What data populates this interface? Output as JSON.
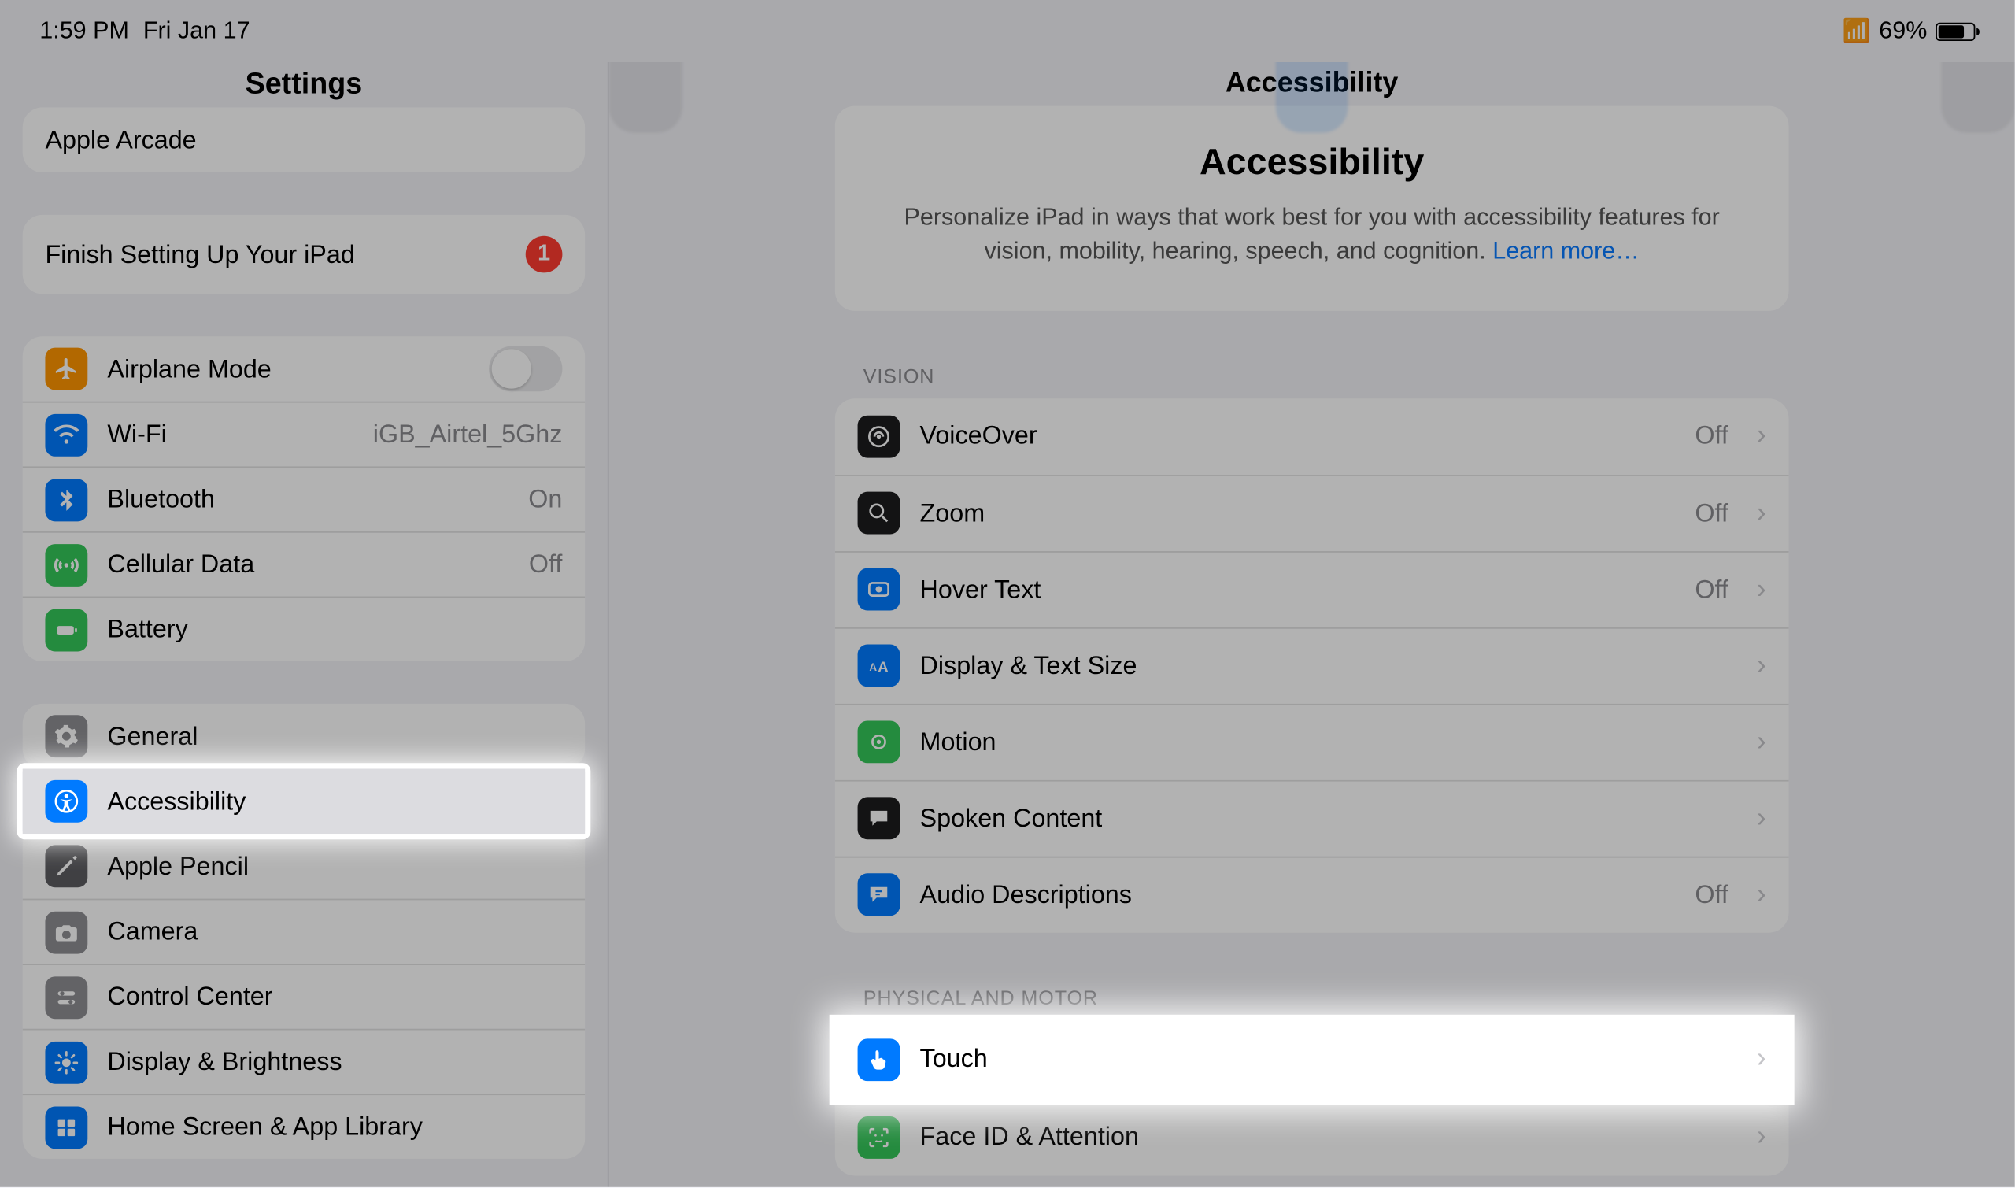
{
  "status": {
    "time": "1:59 PM",
    "date": "Fri Jan 17",
    "battery_pct": "69%"
  },
  "sidebar": {
    "title": "Settings",
    "top_row": {
      "label": "Apple Arcade"
    },
    "setup": {
      "label": "Finish Setting Up Your iPad",
      "badge": "1"
    },
    "conn": {
      "airplane": "Airplane Mode",
      "wifi": "Wi-Fi",
      "wifi_value": "iGB_Airtel_5Ghz",
      "bluetooth": "Bluetooth",
      "bluetooth_value": "On",
      "cellular": "Cellular Data",
      "cellular_value": "Off",
      "battery": "Battery"
    },
    "sys": {
      "general": "General",
      "accessibility": "Accessibility",
      "pencil": "Apple Pencil",
      "camera": "Camera",
      "control_center": "Control Center",
      "display": "Display & Brightness",
      "home": "Home Screen & App Library"
    }
  },
  "detail": {
    "small_title": "Accessibility",
    "hero_title": "Accessibility",
    "hero_text": "Personalize iPad in ways that work best for you with accessibility features for vision, mobility, hearing, speech, and cognition. ",
    "hero_link": "Learn more…",
    "section_vision": "Vision",
    "section_physical": "Physical and Motor",
    "vision": {
      "voiceover": "VoiceOver",
      "voiceover_value": "Off",
      "zoom": "Zoom",
      "zoom_value": "Off",
      "hover": "Hover Text",
      "hover_value": "Off",
      "display": "Display & Text Size",
      "motion": "Motion",
      "spoken": "Spoken Content",
      "audio": "Audio Descriptions",
      "audio_value": "Off"
    },
    "physical": {
      "touch": "Touch",
      "faceid": "Face ID & Attention"
    }
  }
}
